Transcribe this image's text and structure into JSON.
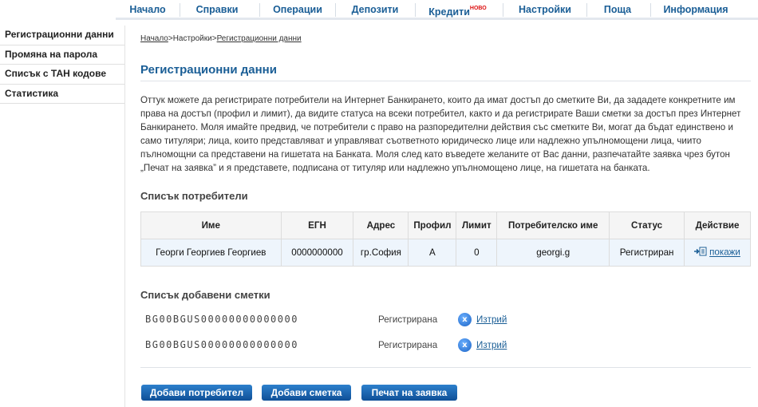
{
  "topnav": {
    "items": [
      "Начало",
      "Справки",
      "Операции",
      "Депозити",
      "Кредити",
      "Настройки",
      "Поща",
      "Информация"
    ],
    "new_badge": "НОВО"
  },
  "sidebar": {
    "items": [
      "Регистрационни данни",
      "Промяна на парола",
      "Списък с ТАН кодове",
      "Статистика"
    ]
  },
  "breadcrumb": {
    "home": "Начало",
    "sep": ">",
    "settings": "Настройки",
    "current": "Регистрационни данни"
  },
  "page": {
    "title": "Регистрационни данни",
    "intro": "Оттук можете да регистрирате потребители на Интернет Банкирането, които да имат достъп до сметките Ви, да зададете конкретните им права на достъп (профил и лимит), да видите статуса на всеки потребител, както и да регистрирате Ваши сметки за достъп през Интернет Банкирането. Моля имайте предвид, че потребители с право на разпоредителни действия със сметките Ви, могат да бъдат единствено и само титуляри; лица, които представляват и управляват съответното юридическо лице или надлежно упълномощени лица, чиито пълномощни са представени на гишетата на Банката. Моля след като въведете желаните от Вас данни, разпечатайте заявка чрез бутон „Печат на заявка” и я представете, подписана от титуляр или надлежно упълномощено лице, на гишетата на банката."
  },
  "users": {
    "title": "Списък потребители",
    "columns": [
      "Име",
      "ЕГН",
      "Адрес",
      "Профил",
      "Лимит",
      "Потребителско име",
      "Статус",
      "Действие"
    ],
    "rows": [
      {
        "name": "Георги Георгиев Георгиев",
        "egn": "0000000000",
        "address": "гр.София",
        "profile": "A",
        "limit": "0",
        "username": "georgi.g",
        "status": "Регистриран",
        "action": "покажи"
      }
    ]
  },
  "accounts": {
    "title": "Списък добавени сметки",
    "rows": [
      {
        "iban": "BG00BGUS00000000000000",
        "status": "Регистрирана",
        "action": "Изтрий"
      },
      {
        "iban": "BG00BGUS00000000000000",
        "status": "Регистрирана",
        "action": "Изтрий"
      }
    ]
  },
  "buttons": {
    "add_user": "Добави потребител",
    "add_account": "Добави сметка",
    "print_request": "Печат на заявка"
  },
  "colors": {
    "accent": "#1a5e96",
    "button": "#1b64b0",
    "row_highlight": "#eef5fc"
  }
}
